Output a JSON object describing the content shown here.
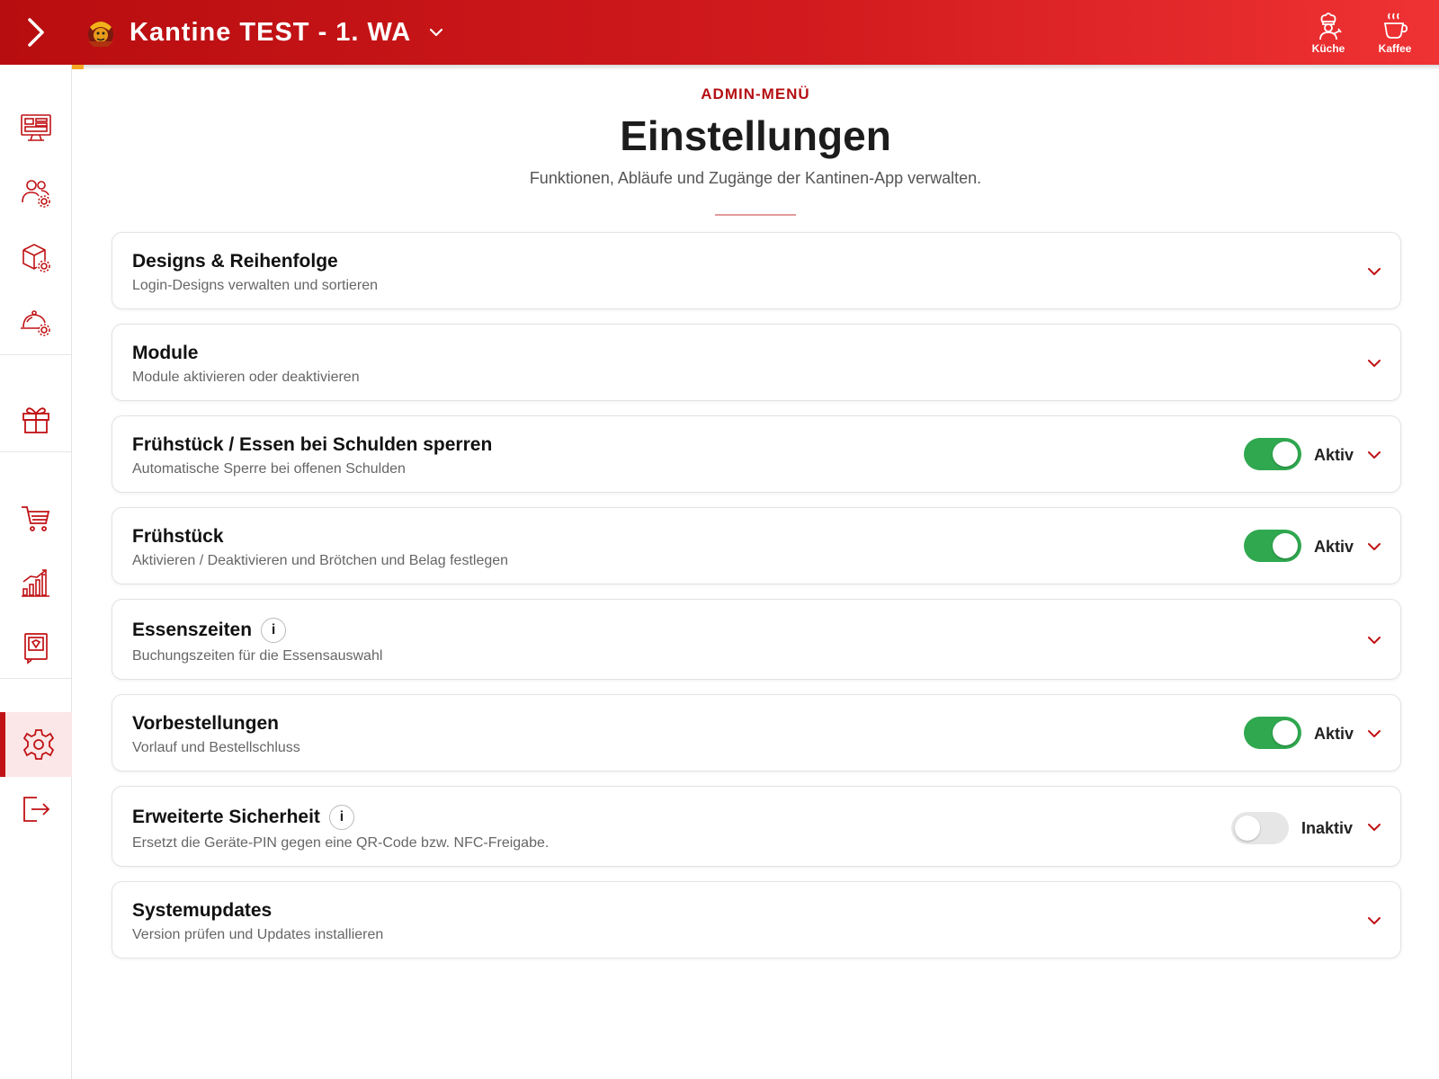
{
  "app": {
    "title": "Kantine TEST - 1. WA",
    "actions": [
      {
        "label": "Küche",
        "icon": "chef-icon"
      },
      {
        "label": "Kaffee",
        "icon": "coffee-cup-icon"
      }
    ]
  },
  "sidebar": {
    "items": [
      {
        "name": "dashboard-monitor",
        "icon": "monitor-dashboard-icon"
      },
      {
        "name": "users-settings",
        "icon": "users-gear-icon"
      },
      {
        "name": "products-settings",
        "icon": "box-gear-icon"
      },
      {
        "name": "meals-settings",
        "icon": "cloche-gear-icon"
      },
      {
        "name": "gifts",
        "icon": "gift-icon"
      },
      {
        "name": "cart",
        "icon": "cart-icon"
      },
      {
        "name": "statistics",
        "icon": "bar-chart-icon"
      },
      {
        "name": "vouchers",
        "icon": "ticket-icon"
      },
      {
        "name": "settings",
        "icon": "gear-icon",
        "active": true
      },
      {
        "name": "logout",
        "icon": "logout-icon"
      }
    ]
  },
  "header": {
    "eyebrow": "ADMIN-MENÜ",
    "title": "Einstellungen",
    "subtitle": "Funktionen, Abläufe und Zugänge der Kantinen-App verwalten."
  },
  "settings": [
    {
      "title": "Designs & Reihenfolge",
      "description": "Login-Designs verwalten und sortieren"
    },
    {
      "title": "Module",
      "description": "Module aktivieren oder deaktivieren"
    },
    {
      "title": "Frühstück / Essen bei Schulden sperren",
      "description": "Automatische Sperre bei offenen Schulden",
      "toggle": true,
      "state_label": "Aktiv"
    },
    {
      "title": "Frühstück",
      "description": "Aktivieren / Deaktivieren und Brötchen und Belag festlegen",
      "toggle": true,
      "state_label": "Aktiv"
    },
    {
      "title": "Essenszeiten",
      "description": "Buchungszeiten für die Essensauswahl",
      "info": "i"
    },
    {
      "title": "Vorbestellungen",
      "description": "Vorlauf und Bestellschluss",
      "toggle": true,
      "state_label": "Aktiv"
    },
    {
      "title": "Erweiterte Sicherheit",
      "description": "Ersetzt die Geräte-PIN gegen eine QR-Code bzw. NFC-Freigabe.",
      "info": "i",
      "toggle": false,
      "state_label": "Inaktiv"
    },
    {
      "title": "Systemupdates",
      "description": "Version prüfen und Updates installieren"
    }
  ],
  "colors": {
    "brand": "#c01215",
    "toggle_on": "#2fa84f",
    "toggle_off": "#e6e6e6"
  }
}
